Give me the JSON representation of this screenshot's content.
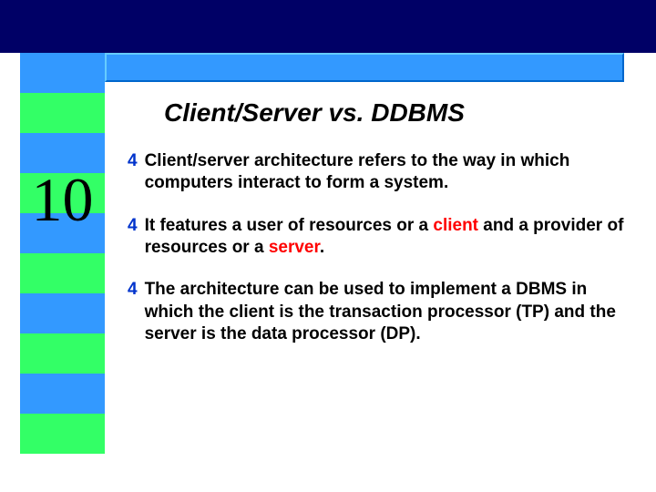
{
  "colors": {
    "dark_band": "#000066",
    "blue_stripe": "#3399ff",
    "green_stripe": "#33ff66",
    "bullet_icon": "#0033cc",
    "highlight_red": "#ff0000"
  },
  "page_number": "10",
  "title": "Client/Server vs. DDBMS",
  "bullets": [
    {
      "lead": "Client/server architecture",
      "rest": "  refers to the way in which computers interact to form a system.",
      "red_terms": []
    },
    {
      "lead": "",
      "rest": "It features a user of resources or a client and a provider of resources or a server.",
      "red_terms": [
        "client",
        "server"
      ]
    },
    {
      "lead": "",
      "rest": "The architecture can be used to implement a DBMS in which the client is the transaction processor (TP) and the server is the data processor (DP).",
      "red_terms": []
    }
  ],
  "bullet_glyph": "4"
}
